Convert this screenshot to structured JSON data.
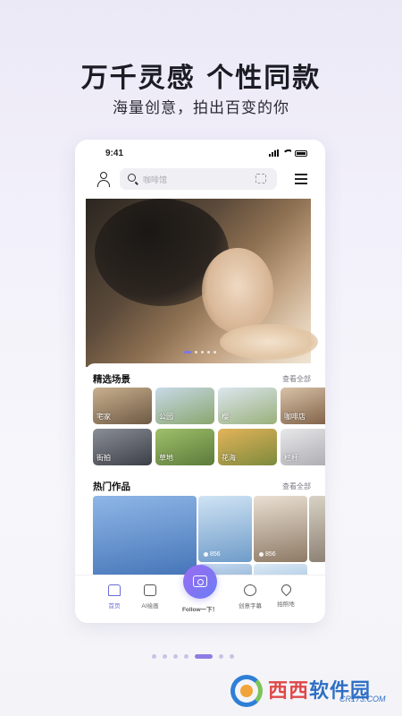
{
  "headline": "万千灵感 个性同款",
  "subheadline": "海量创意，拍出百变的你",
  "status_bar": {
    "time": "9:41"
  },
  "search": {
    "placeholder": "咖啡馆"
  },
  "featured_scenes": {
    "title": "精选场景",
    "more": "查看全部",
    "items": [
      {
        "label": "宅家",
        "color_a": "#c9b08e",
        "color_b": "#6e5a44"
      },
      {
        "label": "公园",
        "color_a": "#c8d9e8",
        "color_b": "#8aa66e"
      },
      {
        "label": "樱",
        "color_a": "#dbe6ef",
        "color_b": "#9ab07a"
      },
      {
        "label": "咖啡店",
        "color_a": "#d8c2a8",
        "color_b": "#7a5a40"
      },
      {
        "label": "街拍",
        "color_a": "#8a8e96",
        "color_b": "#3c3f46"
      },
      {
        "label": "草地",
        "color_a": "#9fc06a",
        "color_b": "#5c7a3a"
      },
      {
        "label": "花海",
        "color_a": "#e4b35a",
        "color_b": "#7c8a3c"
      },
      {
        "label": "栏杆",
        "color_a": "#e8e8ea",
        "color_b": "#a8a8ae"
      }
    ]
  },
  "hot_works": {
    "title": "热门作品",
    "more": "查看全部",
    "items": [
      {
        "likes": "",
        "color_a": "#8fb6e6",
        "color_b": "#3e6fb4"
      },
      {
        "likes": "856",
        "color_a": "#cfe3f4",
        "color_b": "#6f9cc9"
      },
      {
        "likes": "856",
        "color_a": "#e9dfd2",
        "color_b": "#8e7a66"
      },
      {
        "likes": "",
        "color_a": "#d8d2c6",
        "color_b": "#8d8274"
      },
      {
        "likes": "",
        "color_a": "#c5daf0",
        "color_b": "#8fb0d4"
      },
      {
        "likes": "",
        "color_a": "#dbe9f5",
        "color_b": "#a9c6e3"
      }
    ]
  },
  "tabbar": {
    "home": "首页",
    "ai_draw": "AI绘画",
    "follow": "Follow一下！",
    "creative": "创意字幕",
    "spot": "拍照地"
  },
  "colors": {
    "accent": "#6a6ad8",
    "pager_active": "#8f7ce3"
  },
  "watermark": {
    "brand_a": "西西",
    "brand_b": "软件园",
    "domain": "CR173.COM"
  }
}
